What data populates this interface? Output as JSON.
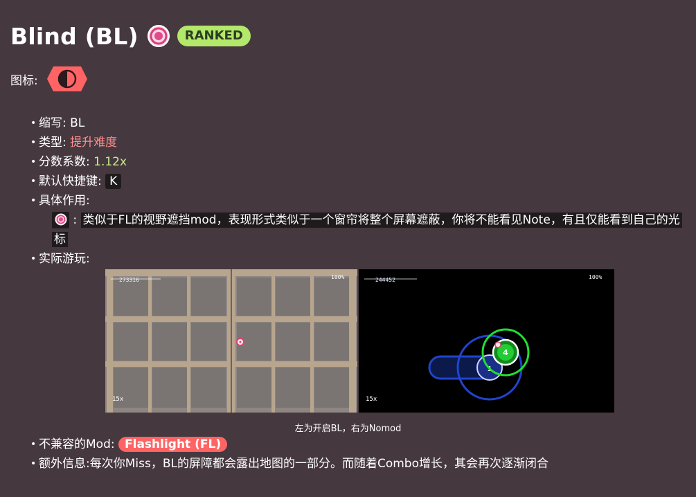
{
  "header": {
    "title": "Blind (BL)",
    "badge": "RANKED"
  },
  "icon_row": {
    "label": "图标:",
    "icon_name": "blind-mod-icon",
    "icon_color": "#ff6464"
  },
  "props": {
    "abbr_label": "缩写:",
    "abbr_value": "BL",
    "type_label": "类型:",
    "type_value": "提升难度",
    "type_color": "#ff8e8e",
    "mult_label": "分数系数:",
    "mult_value": "1.12x",
    "mult_color": "#c8f08a",
    "hotkey_label": "默认快捷键:",
    "hotkey_value": "K",
    "effect_label": "具体作用:",
    "effect_sep": ":",
    "effect_text": "类似于FL的视野遮挡mod，表现形式类似于一个窗帘将整个屏幕遮蔽，你将不能看见Note，有且仅能看到自己的光标",
    "gameplay_label": "实际游玩:"
  },
  "gameplay": {
    "left_score": "273316",
    "left_acc": "100%",
    "left_combo": "15x",
    "right_score": "244452",
    "right_acc": "100%",
    "right_combo": "15x",
    "hit_number_front": "4",
    "hit_number_back": "1",
    "caption": "左为开启BL，右为Nomod"
  },
  "bottom": {
    "incompat_label": "不兼容的Mod:",
    "incompat_mod": "Flashlight (FL)",
    "extra_text": "额外信息:每次你Miss，BL的屏障都会露出地图的一部分。而随着Combo增长，其会再次逐渐闭合"
  },
  "colors": {
    "background": "#46383f",
    "ranked": "#b3e86a",
    "approach_green": "#22dd33",
    "slider_blue": "#2244cc"
  }
}
